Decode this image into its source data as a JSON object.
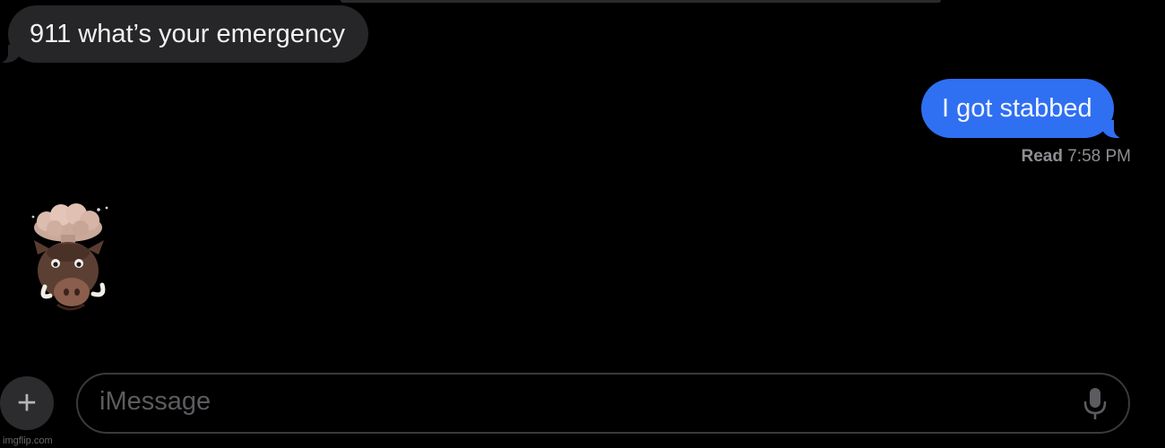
{
  "conversation": {
    "messages": [
      {
        "direction": "incoming",
        "text": "911 what’s your emergency"
      },
      {
        "direction": "outgoing",
        "text": "I got stabbed"
      }
    ],
    "receipt": {
      "label": "Read",
      "time": "7:58 PM"
    },
    "sticker": {
      "icon": "boar-memoji-mind-blown-icon"
    }
  },
  "composer": {
    "add_symbol": "+",
    "placeholder": "iMessage",
    "mic_icon": "microphone-icon"
  },
  "watermark": "imgflip.com",
  "colors": {
    "background": "#000000",
    "incoming_bubble": "#262628",
    "outgoing_bubble": "#2f6ff2",
    "secondary_text": "#8e8e93"
  }
}
